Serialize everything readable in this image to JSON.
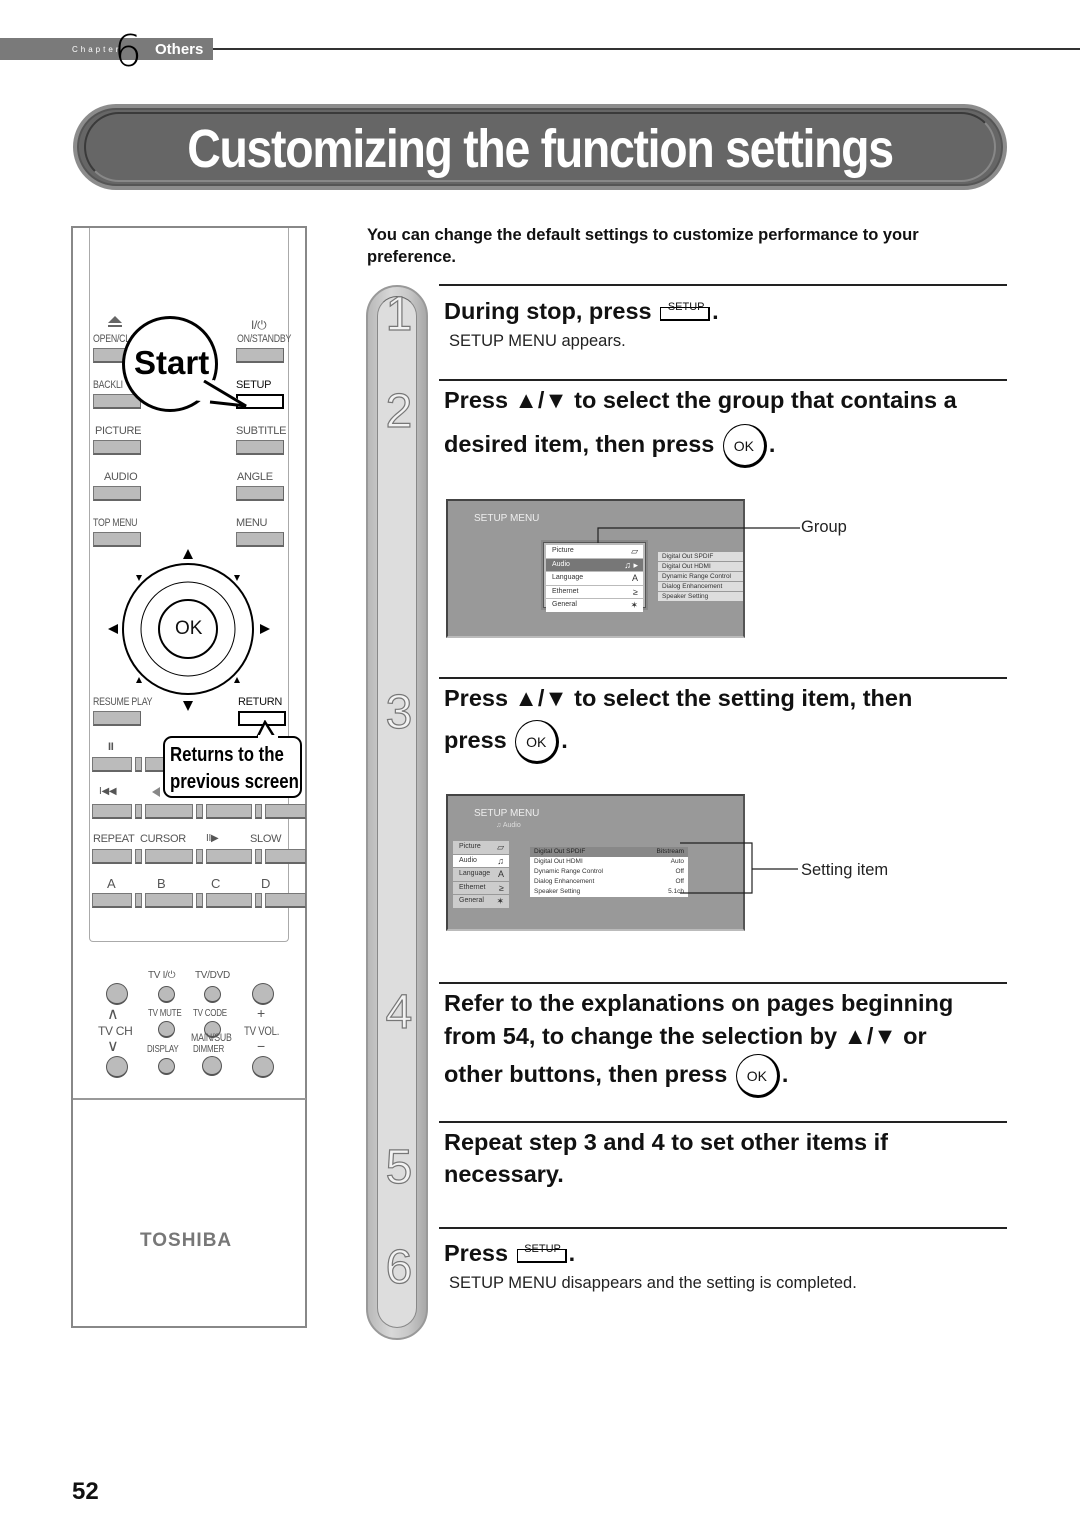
{
  "chapter": {
    "word": "Chapter",
    "number": "6",
    "name": "Others"
  },
  "title": "Customizing the function settings",
  "intro": "You can change the default settings to customize performance to your preference.",
  "remote": {
    "labels": {
      "open_close": "OPEN/CLO",
      "on_standby": "ON/STANDBY",
      "power_glyph": "I/⏻",
      "backlight": "BACKLI",
      "setup": "SETUP",
      "picture": "PICTURE",
      "subtitle": "SUBTITLE",
      "audio": "AUDIO",
      "angle": "ANGLE",
      "top_menu": "TOP MENU",
      "menu": "MENU",
      "ok": "OK",
      "resume_play": "RESUME PLAY",
      "return": "RETURN",
      "pause": "II",
      "skip_back": "I◀◀",
      "repeat": "REPEAT",
      "cursor": "CURSOR",
      "slow_fwd": "II▶",
      "slow": "SLOW",
      "a": "A",
      "b": "B",
      "c": "C",
      "d": "D",
      "tv_power": "TV  I/⏻",
      "tv_dvd": "TV/DVD",
      "tv_mute": "TV MUTE",
      "tv_code": "TV CODE",
      "tv_ch": "TV CH",
      "main_sub": "MAIN/SUB",
      "tv_vol": "TV VOL.",
      "plus": "+",
      "minus": "−",
      "ch_up": "∧",
      "ch_down": "∨",
      "display": "DISPLAY",
      "dimmer": "DIMMER"
    },
    "start_bubble": "Start",
    "return_bubble_line1": "Returns to the",
    "return_bubble_line2": "previous screen",
    "brand": "TOSHIBA"
  },
  "steps": [
    {
      "num": "1",
      "head_pre": "During stop, press",
      "key": "SETUP",
      "head_post": ".",
      "sub": "SETUP MENU  appears."
    },
    {
      "num": "2",
      "line1": "Press ▲/▼ to select the group that contains a",
      "line2_pre": "desired item, then press",
      "key": "OK",
      "line2_post": "."
    },
    {
      "num": "3",
      "line1": "Press ▲/▼ to select the setting item, then",
      "line2_pre": "press",
      "key": "OK",
      "line2_post": "."
    },
    {
      "num": "4",
      "line1": "Refer to the explanations on pages beginning",
      "line2": "from 54, to change the selection by ▲/▼ or",
      "line3_pre": "other buttons, then press",
      "key": "OK",
      "line3_post": "."
    },
    {
      "num": "5",
      "line1": "Repeat step 3 and 4 to set other items if",
      "line2": "necessary."
    },
    {
      "num": "6",
      "head_pre": "Press",
      "key": "SETUP",
      "head_post": ".",
      "sub": "SETUP MENU  disappears and the setting is completed."
    }
  ],
  "screen1": {
    "title": "SETUP MENU",
    "groups": [
      {
        "label": "Picture",
        "icon": "▱",
        "selected": false
      },
      {
        "label": "Audio",
        "icon": "♫ ▸",
        "selected": true
      },
      {
        "label": "Language",
        "icon": "A",
        "selected": false
      },
      {
        "label": "Ethernet",
        "icon": "≥",
        "selected": false
      },
      {
        "label": "General",
        "icon": "✶",
        "selected": false
      }
    ],
    "items": [
      "Digital Out SPDIF",
      "Digital Out HDMI",
      "Dynamic Range Control",
      "Dialog Enhancement",
      "Speaker Setting"
    ],
    "callout": "Group"
  },
  "screen2": {
    "title": "SETUP MENU",
    "subtitle": "Audio",
    "groups": [
      {
        "label": "Picture",
        "icon": "▱"
      },
      {
        "label": "Audio",
        "icon": "♫"
      },
      {
        "label": "Language",
        "icon": "A"
      },
      {
        "label": "Ethernet",
        "icon": "≥"
      },
      {
        "label": "General",
        "icon": "✶"
      }
    ],
    "settings": [
      {
        "name": "Digital Out SPDIF",
        "value": "Bitstream",
        "selected": true
      },
      {
        "name": "Digital Out HDMI",
        "value": "Auto",
        "selected": false
      },
      {
        "name": "Dynamic Range Control",
        "value": "Off",
        "selected": false
      },
      {
        "name": "Dialog Enhancement",
        "value": "Off",
        "selected": false
      },
      {
        "name": "Speaker Setting",
        "value": "5.1ch",
        "selected": false
      }
    ],
    "callout": "Setting item"
  },
  "page_number": "52"
}
